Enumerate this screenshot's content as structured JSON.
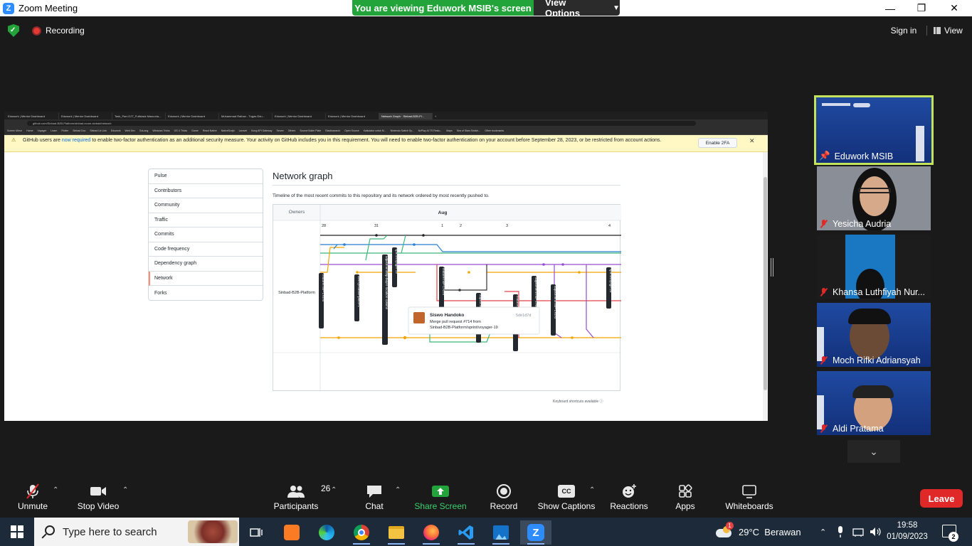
{
  "window": {
    "title": "Zoom Meeting",
    "viewing_banner": "You are viewing Eduwork MSIB's screen",
    "view_options": "View Options"
  },
  "topbar": {
    "recording": "Recording",
    "sign_in": "Sign in",
    "view": "View"
  },
  "shared_screen": {
    "browser_tabs": [
      "Eduwork | Mentor Dashboard",
      "Eduwork | Mentor Dashboard",
      "Task_Part-OJT_Fullstack Mascoria...",
      "Eduwork | Mentor Dashboard",
      "Muhammad Raihan - Tugas Edu...",
      "Eduwork | Mentor Dashboard",
      "Eduwork | Mentor Dashboard",
      "Network Graph · Sinbad-B2B-Pl..."
    ],
    "url": "github.com/Sinbad-B2B-Platform/sinbad-ecom-sinbad/network",
    "bookmarks": [
      "Screen Mirror",
      "Home",
      "Voyager",
      "Learn",
      "Flutter",
      "Sinbad Doc",
      "Sinbad Ux Link",
      "Eduwork",
      "Web Dev",
      "GoLang",
      "Windows Tricks",
      "OS X Tricks",
      "Game",
      "React Native",
      "NativeScript",
      "Laravel",
      "Kong API Gateway",
      "Server",
      "Others",
      "Source Boiler Plate",
      "Elasticsearch",
      "Open Source",
      "Kalkulator untuk M...",
      "Nintendo Switch Sy...",
      "NxPlay AI TS Resto...",
      "Maps",
      "Sea of Stars Switch...",
      "Other bookmarks"
    ],
    "banner": {
      "text_before": "GitHub users are ",
      "link": "now required",
      "text_after": " to enable two-factor authentication as an additional security measure. Your activity on GitHub includes you in this requirement. You will need to enable two-factor authentication on your account before September 28, 2023, or be restricted from account actions.",
      "button": "Enable 2FA"
    },
    "sidebar": [
      "Pulse",
      "Contributors",
      "Community",
      "Traffic",
      "Commits",
      "Code frequency",
      "Dependency graph",
      "Network",
      "Forks"
    ],
    "selected_sidebar": "Network",
    "heading": "Network graph",
    "description": "Timeline of the most recent commits to this repository and its network ordered by most recently pushed to.",
    "graph": {
      "owners_header": "Owners",
      "month": "Aug",
      "owner": "Sinbad-B2B-Platform",
      "dates": [
        "28",
        "31",
        "1",
        "2",
        "3",
        "4"
      ],
      "branch_labels": [
        "feature/TBP-17075",
        "dev/syncbase-patch-1",
        "adjustment/tbp-buyer-location-column",
        "sprint/voyager-19",
        "feature/TBP-17078",
        "adjustment/TBP-17442",
        "feature/TBP-17...",
        "adjustment/TBP-17662",
        "adjustment/TBP-17070",
        "sprint/voyage-20"
      ],
      "tooltip": {
        "author": "Siswo Handoko",
        "sha": "5de1d7d",
        "line1": "Merge pull request #714 from",
        "line2": "Sinbad-B2B-Platform/sprint/voyager-19"
      }
    },
    "keyboard_hint": "Keyboard shortcuts available"
  },
  "participants": [
    {
      "name": "Eduwork MSIB",
      "pinned": true
    },
    {
      "name": "Yesicha Audria",
      "muted": true
    },
    {
      "name": "Khansa Luthfiyah Nur...",
      "muted": true
    },
    {
      "name": "Moch Rifki Adriansyah",
      "muted": true
    },
    {
      "name": "Aldi Pratama",
      "muted": true
    }
  ],
  "toolbar": {
    "unmute": "Unmute",
    "stop_video": "Stop Video",
    "participants": "Participants",
    "participants_count": "26",
    "chat": "Chat",
    "share_screen": "Share Screen",
    "record": "Record",
    "show_captions": "Show Captions",
    "captions_badge": "CC",
    "reactions": "Reactions",
    "apps": "Apps",
    "whiteboards": "Whiteboards",
    "leave": "Leave"
  },
  "taskbar": {
    "search_placeholder": "Type here to search",
    "weather": "29°C  Berawan",
    "weather_badge": "1",
    "time": "19:58",
    "date": "01/09/2023",
    "notifications": "2"
  },
  "colors": {
    "zoom_blue": "#2d8cff",
    "viewing_green": "#23a43a",
    "leave_red": "#e02828",
    "active_speaker": "#c5e35a"
  }
}
